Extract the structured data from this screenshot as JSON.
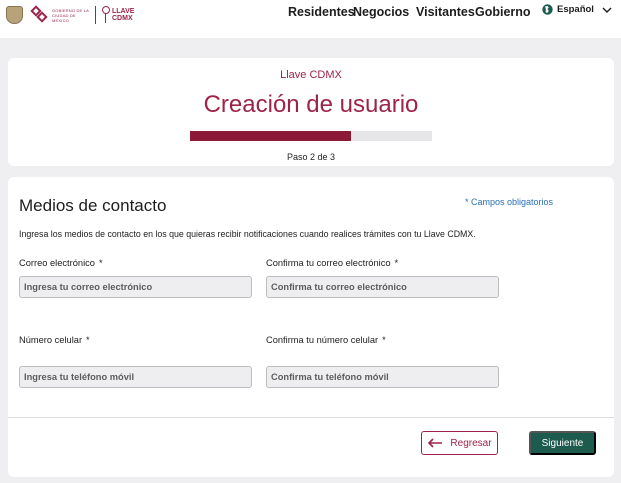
{
  "header": {
    "gov_logo_text": "GOBIERNO DE LA CIUDAD DE MÉXICO",
    "brand_line1": "LLAVE",
    "brand_line2": "CDMX",
    "nav": [
      "Residentes",
      "Negocios",
      "Visitantes",
      "Gobierno"
    ],
    "language": "Español",
    "icons": {
      "language": "globe-icon",
      "dropdown": "chevron-down-icon"
    }
  },
  "progress_card": {
    "subtitle": "Llave CDMX",
    "title": "Creación de usuario",
    "progress_fraction": 0.667,
    "step_text": "Paso 2 de 3"
  },
  "form": {
    "section_title": "Medios de contacto",
    "required_note": "* Campos obligatorios",
    "intro": "Ingresa los medios de contacto en los que quieras recibir notificaciones cuando realices trámites con tu Llave CDMX.",
    "fields": [
      {
        "label": "Correo electrónico",
        "required_mark": "*",
        "placeholder": "Ingresa tu correo electrónico",
        "value": ""
      },
      {
        "label": "Confirma tu correo electrónico",
        "required_mark": "*",
        "placeholder": "Confirma tu correo electrónico",
        "value": ""
      },
      {
        "label": "Número celular",
        "required_mark": "*",
        "placeholder": "Ingresa tu teléfono móvil",
        "value": ""
      },
      {
        "label": "Confirma tu número celular",
        "required_mark": "*",
        "placeholder": "Confirma tu teléfono móvil",
        "value": ""
      }
    ]
  },
  "actions": {
    "back_label": "Regresar",
    "next_label": "Siguiente",
    "back_icon": "arrow-left-icon"
  },
  "colors": {
    "brand": "#9d2449",
    "progress_fill": "#8c1a37",
    "primary_button": "#1e5b4f",
    "link": "#2a6fb5"
  }
}
